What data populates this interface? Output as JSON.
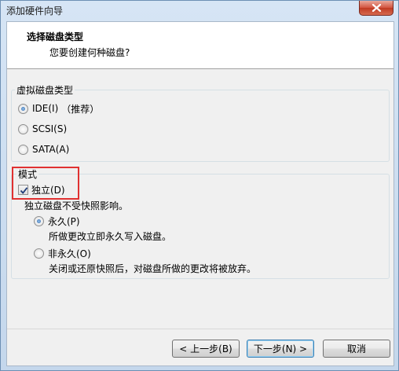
{
  "window": {
    "title": "添加硬件向导"
  },
  "header": {
    "title": "选择磁盘类型",
    "subtitle": "您要创建何种磁盘?"
  },
  "disk_type": {
    "legend": "虚拟磁盘类型",
    "options": [
      {
        "label": "IDE(I)",
        "note": "（推荐）",
        "selected": true
      },
      {
        "label": "SCSI(S)",
        "selected": false
      },
      {
        "label": "SATA(A)",
        "selected": false
      }
    ]
  },
  "mode": {
    "legend": "模式",
    "independent": {
      "label": "独立(D)",
      "checked": true,
      "description": "独立磁盘不受快照影响。"
    },
    "options": [
      {
        "label": "永久(P)",
        "description": "所做更改立即永久写入磁盘。",
        "selected": true
      },
      {
        "label": "非永久(O)",
        "description": "关闭或还原快照后，对磁盘所做的更改将被放弃。",
        "selected": false
      }
    ]
  },
  "buttons": {
    "back": "< 上一步(B)",
    "next": "下一步(N) >",
    "cancel": "取消"
  },
  "colors": {
    "highlight": "#e03131",
    "accent": "#2a63a6"
  }
}
